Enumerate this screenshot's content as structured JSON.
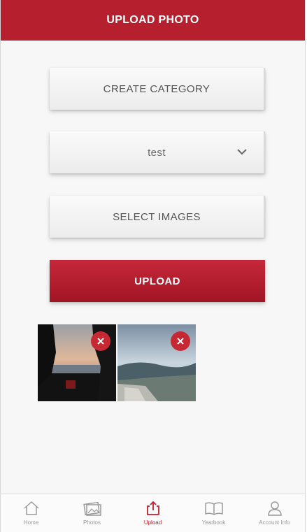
{
  "header": {
    "title": "UPLOAD PHOTO"
  },
  "actions": {
    "create_category": "CREATE CATEGORY",
    "category_value": "test",
    "select_images": "SELECT IMAGES",
    "upload": "UPLOAD"
  },
  "images": [
    {
      "name": "sunset-lake-photo"
    },
    {
      "name": "mountain-view-photo"
    }
  ],
  "tabs": [
    {
      "label": "Home",
      "icon": "home-icon",
      "active": false
    },
    {
      "label": "Photos",
      "icon": "photos-icon",
      "active": false
    },
    {
      "label": "Upload",
      "icon": "upload-icon",
      "active": true
    },
    {
      "label": "Yearbook",
      "icon": "book-icon",
      "active": false
    },
    {
      "label": "Account Info",
      "icon": "person-icon",
      "active": false
    }
  ],
  "colors": {
    "brand": "#b51f2e",
    "remove": "#c62834",
    "active_tab": "#c41f2f"
  }
}
